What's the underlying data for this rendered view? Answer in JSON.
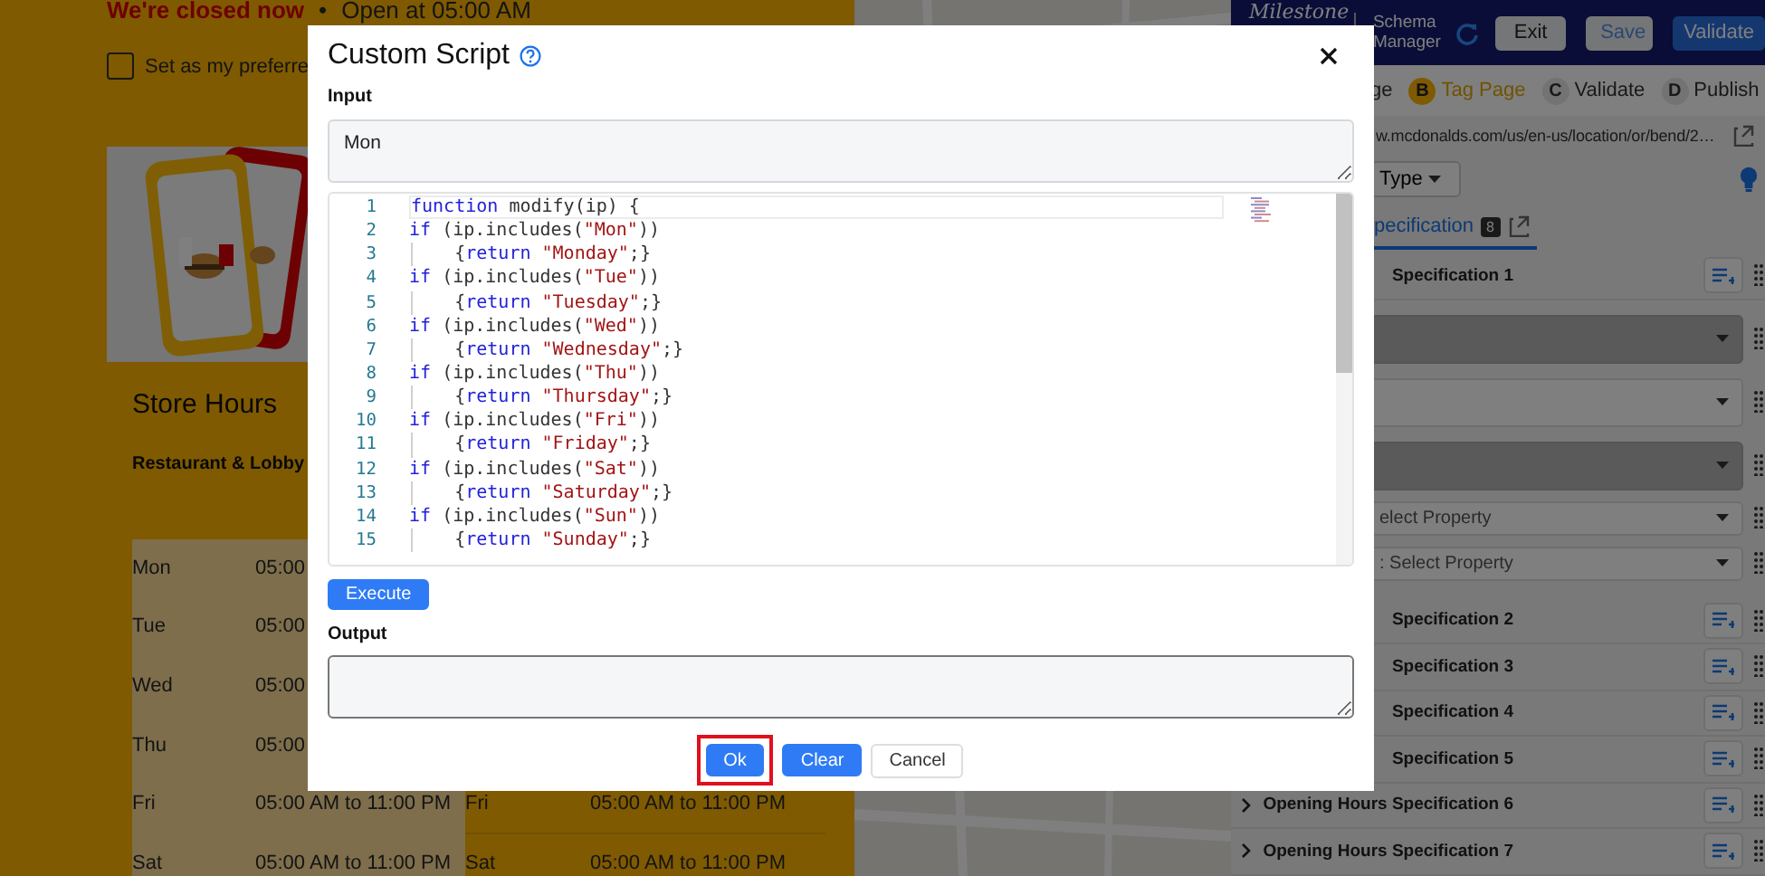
{
  "store_page": {
    "status": {
      "closed": "We're closed now",
      "separator": "•",
      "opens": "Open at 05:00 AM"
    },
    "preferred": {
      "label": "Set as my preferre",
      "checked": false
    },
    "title": "Store Hours",
    "subtitle": "Restaurant & Lobby",
    "hours_rows": [
      {
        "cells": [
          "Mon",
          "05:00"
        ]
      },
      {
        "cells": [
          "Tue",
          "05:00"
        ]
      },
      {
        "cells": [
          "Wed",
          "05:00"
        ]
      },
      {
        "cells": [
          "Thu",
          "05:00"
        ]
      },
      {
        "cells": [
          "Fri",
          "05:00 AM to 11:00 PM",
          "Fri",
          "05:00 AM to 11:00 PM"
        ]
      },
      {
        "cells": [
          "Sat",
          "05:00 AM to 11:00 PM",
          "Sat",
          "05:00 AM to 11:00 PM"
        ]
      }
    ]
  },
  "app_panel": {
    "logo": "Milestone",
    "product": "Schema Manager",
    "buttons": [
      {
        "label": "Exit",
        "kind": "light"
      },
      {
        "label": "Save",
        "kind": "light-accent"
      },
      {
        "label": "Validate",
        "kind": "primary"
      }
    ],
    "steps": [
      {
        "label": "ge",
        "selected": false
      },
      {
        "letter": "B",
        "label": "Tag Page",
        "selected": true
      },
      {
        "letter": "C",
        "label": "Validate",
        "selected": false
      },
      {
        "letter": "D",
        "label": "Publish",
        "selected": false
      }
    ],
    "url": "w.mcdonalds.com/us/en-us/location/or/bend/2…",
    "type_dropdown": "Type",
    "tab": {
      "label": "pecification",
      "count": "8",
      "selected": true
    },
    "specifications": [
      {
        "label": "Specification 1",
        "fields": [
          {
            "disabled": true
          },
          {
            "disabled": false
          },
          {
            "disabled": true
          },
          {
            "placeholder": "elect Property",
            "disabled": false
          },
          {
            "placeholder": ": Select Property",
            "disabled": false
          }
        ]
      },
      {
        "label": "Specification 2"
      },
      {
        "label": "Specification 3"
      },
      {
        "label": "Specification 4"
      },
      {
        "label": "Specification 5"
      },
      {
        "label": "Opening Hours Specification 6",
        "chevron": true
      },
      {
        "label": "Opening Hours Specification 7",
        "chevron": true
      }
    ]
  },
  "dialog": {
    "title": "Custom Script",
    "input_label": "Input",
    "input_value": "Mon",
    "code_lines": [
      {
        "number": "1",
        "indent": false,
        "current": true,
        "tokens": [
          {
            "kind": "kw",
            "text": "function"
          },
          {
            "kind": "plain",
            "text": " modify(ip) {"
          }
        ]
      },
      {
        "number": "2",
        "indent": false,
        "current": false,
        "tokens": [
          {
            "kind": "kw",
            "text": "if"
          },
          {
            "kind": "plain",
            "text": " (ip.includes("
          },
          {
            "kind": "str",
            "text": "\"Mon\""
          },
          {
            "kind": "plain",
            "text": "))"
          }
        ]
      },
      {
        "number": "3",
        "indent": true,
        "current": false,
        "tokens": [
          {
            "kind": "plain",
            "text": "{"
          },
          {
            "kind": "kw",
            "text": "return"
          },
          {
            "kind": "str",
            "text": " \"Monday\""
          },
          {
            "kind": "plain",
            "text": ";}"
          }
        ]
      },
      {
        "number": "4",
        "indent": false,
        "current": false,
        "tokens": [
          {
            "kind": "kw",
            "text": "if"
          },
          {
            "kind": "plain",
            "text": " (ip.includes("
          },
          {
            "kind": "str",
            "text": "\"Tue\""
          },
          {
            "kind": "plain",
            "text": "))"
          }
        ]
      },
      {
        "number": "5",
        "indent": true,
        "current": false,
        "tokens": [
          {
            "kind": "plain",
            "text": "{"
          },
          {
            "kind": "kw",
            "text": "return"
          },
          {
            "kind": "str",
            "text": " \"Tuesday\""
          },
          {
            "kind": "plain",
            "text": ";}"
          }
        ]
      },
      {
        "number": "6",
        "indent": false,
        "current": false,
        "tokens": [
          {
            "kind": "kw",
            "text": "if"
          },
          {
            "kind": "plain",
            "text": " (ip.includes("
          },
          {
            "kind": "str",
            "text": "\"Wed\""
          },
          {
            "kind": "plain",
            "text": "))"
          }
        ]
      },
      {
        "number": "7",
        "indent": true,
        "current": false,
        "tokens": [
          {
            "kind": "plain",
            "text": "{"
          },
          {
            "kind": "kw",
            "text": "return"
          },
          {
            "kind": "str",
            "text": " \"Wednesday\""
          },
          {
            "kind": "plain",
            "text": ";}"
          }
        ]
      },
      {
        "number": "8",
        "indent": false,
        "current": false,
        "tokens": [
          {
            "kind": "kw",
            "text": "if"
          },
          {
            "kind": "plain",
            "text": " (ip.includes("
          },
          {
            "kind": "str",
            "text": "\"Thu\""
          },
          {
            "kind": "plain",
            "text": "))"
          }
        ]
      },
      {
        "number": "9",
        "indent": true,
        "current": false,
        "tokens": [
          {
            "kind": "plain",
            "text": "{"
          },
          {
            "kind": "kw",
            "text": "return"
          },
          {
            "kind": "str",
            "text": " \"Thursday\""
          },
          {
            "kind": "plain",
            "text": ";}"
          }
        ]
      },
      {
        "number": "10",
        "indent": false,
        "current": false,
        "tokens": [
          {
            "kind": "kw",
            "text": "if"
          },
          {
            "kind": "plain",
            "text": " (ip.includes("
          },
          {
            "kind": "str",
            "text": "\"Fri\""
          },
          {
            "kind": "plain",
            "text": "))"
          }
        ]
      },
      {
        "number": "11",
        "indent": true,
        "current": false,
        "tokens": [
          {
            "kind": "plain",
            "text": "{"
          },
          {
            "kind": "kw",
            "text": "return"
          },
          {
            "kind": "str",
            "text": " \"Friday\""
          },
          {
            "kind": "plain",
            "text": ";}"
          }
        ]
      },
      {
        "number": "12",
        "indent": false,
        "current": false,
        "tokens": [
          {
            "kind": "kw",
            "text": "if"
          },
          {
            "kind": "plain",
            "text": " (ip.includes("
          },
          {
            "kind": "str",
            "text": "\"Sat\""
          },
          {
            "kind": "plain",
            "text": "))"
          }
        ]
      },
      {
        "number": "13",
        "indent": true,
        "current": false,
        "tokens": [
          {
            "kind": "plain",
            "text": "{"
          },
          {
            "kind": "kw",
            "text": "return"
          },
          {
            "kind": "str",
            "text": " \"Saturday\""
          },
          {
            "kind": "plain",
            "text": ";}"
          }
        ]
      },
      {
        "number": "14",
        "indent": false,
        "current": false,
        "tokens": [
          {
            "kind": "kw",
            "text": "if"
          },
          {
            "kind": "plain",
            "text": " (ip.includes("
          },
          {
            "kind": "str",
            "text": "\"Sun\""
          },
          {
            "kind": "plain",
            "text": "))"
          }
        ]
      },
      {
        "number": "15",
        "indent": true,
        "current": false,
        "tokens": [
          {
            "kind": "plain",
            "text": "{"
          },
          {
            "kind": "kw",
            "text": "return"
          },
          {
            "kind": "str",
            "text": " \"Sunday\""
          },
          {
            "kind": "plain",
            "text": ";}"
          }
        ]
      }
    ],
    "execute": "Execute",
    "output_label": "Output",
    "buttons": [
      {
        "label": "Ok",
        "kind": "primary",
        "highlighted": true
      },
      {
        "label": "Clear",
        "kind": "primary",
        "highlighted": false
      },
      {
        "label": "Cancel",
        "kind": "outline",
        "highlighted": false
      }
    ]
  }
}
